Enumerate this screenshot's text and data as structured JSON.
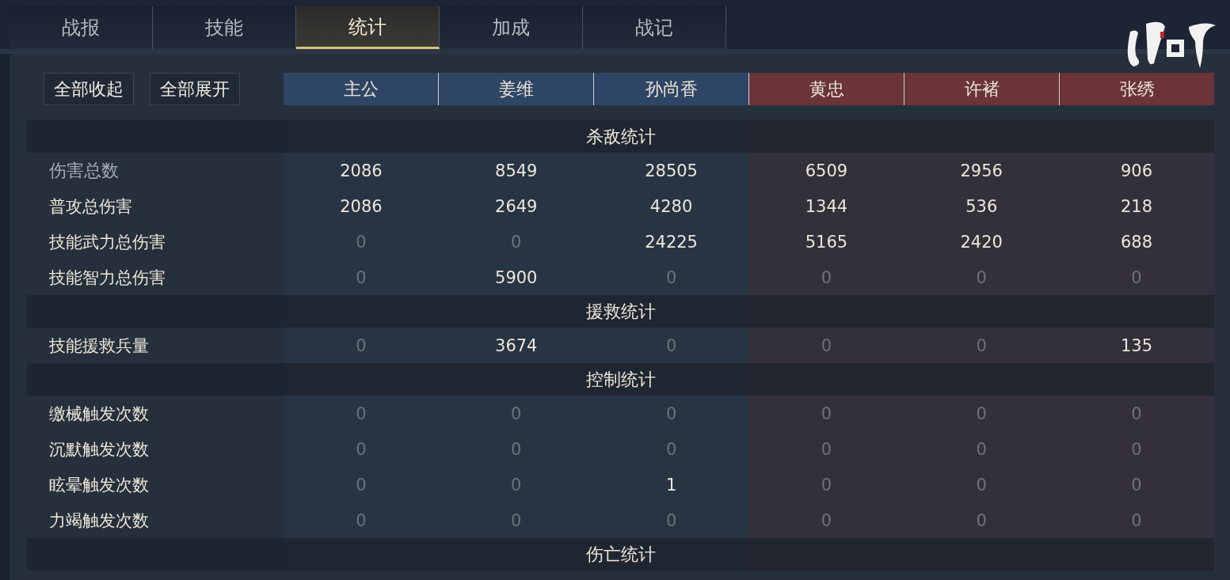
{
  "tabs": [
    {
      "label": "战报",
      "selected": false
    },
    {
      "label": "技能",
      "selected": false
    },
    {
      "label": "统计",
      "selected": true
    },
    {
      "label": "加成",
      "selected": false
    },
    {
      "label": "战记",
      "selected": false
    }
  ],
  "buttons": [
    "全部收起",
    "全部展开"
  ],
  "columns": [
    {
      "name": "主公",
      "color": "#2f4566"
    },
    {
      "name": "姜维",
      "color": "#2f4566"
    },
    {
      "name": "孙尚香",
      "color": "#2f4566"
    },
    {
      "name": "黄忠",
      "color": "#6a3438"
    },
    {
      "name": "许褚",
      "color": "#6a3438"
    },
    {
      "name": "张绣",
      "color": "#6a3438"
    }
  ],
  "sections": [
    {
      "title": "杀敌统计",
      "rows": [
        {
          "label": "伤害总数",
          "muted": true,
          "cells": [
            {
              "text": "2086",
              "muted": false
            },
            {
              "text": "8549",
              "muted": false
            },
            {
              "text": "28505",
              "muted": false
            },
            {
              "text": "6509",
              "muted": false
            },
            {
              "text": "2956",
              "muted": false
            },
            {
              "text": "906",
              "muted": false
            }
          ]
        },
        {
          "label": "普攻总伤害",
          "muted": false,
          "cells": [
            {
              "text": "2086",
              "muted": false
            },
            {
              "text": "2649",
              "muted": false
            },
            {
              "text": "4280",
              "muted": false
            },
            {
              "text": "1344",
              "muted": false
            },
            {
              "text": "536",
              "muted": false
            },
            {
              "text": "218",
              "muted": false
            }
          ]
        },
        {
          "label": "技能武力总伤害",
          "muted": false,
          "cells": [
            {
              "text": "0",
              "muted": true
            },
            {
              "text": "0",
              "muted": true
            },
            {
              "text": "24225",
              "muted": false
            },
            {
              "text": "5165",
              "muted": false
            },
            {
              "text": "2420",
              "muted": false
            },
            {
              "text": "688",
              "muted": false
            }
          ]
        },
        {
          "label": "技能智力总伤害",
          "muted": false,
          "cells": [
            {
              "text": "0",
              "muted": true
            },
            {
              "text": "5900",
              "muted": false
            },
            {
              "text": "0",
              "muted": true
            },
            {
              "text": "0",
              "muted": true
            },
            {
              "text": "0",
              "muted": true
            },
            {
              "text": "0",
              "muted": true
            }
          ]
        }
      ]
    },
    {
      "title": "援救统计",
      "rows": [
        {
          "label": "技能援救兵量",
          "muted": false,
          "cells": [
            {
              "text": "0",
              "muted": true
            },
            {
              "text": "3674",
              "muted": false
            },
            {
              "text": "0",
              "muted": true
            },
            {
              "text": "0",
              "muted": true
            },
            {
              "text": "0",
              "muted": true
            },
            {
              "text": "135",
              "muted": false
            }
          ]
        }
      ]
    },
    {
      "title": "控制统计",
      "rows": [
        {
          "label": "缴械触发次数",
          "muted": false,
          "cells": [
            {
              "text": "0",
              "muted": true
            },
            {
              "text": "0",
              "muted": true
            },
            {
              "text": "0",
              "muted": true
            },
            {
              "text": "0",
              "muted": true
            },
            {
              "text": "0",
              "muted": true
            },
            {
              "text": "0",
              "muted": true
            }
          ]
        },
        {
          "label": "沉默触发次数",
          "muted": false,
          "cells": [
            {
              "text": "0",
              "muted": true
            },
            {
              "text": "0",
              "muted": true
            },
            {
              "text": "0",
              "muted": true
            },
            {
              "text": "0",
              "muted": true
            },
            {
              "text": "0",
              "muted": true
            },
            {
              "text": "0",
              "muted": true
            }
          ]
        },
        {
          "label": "眩晕触发次数",
          "muted": false,
          "cells": [
            {
              "text": "0",
              "muted": true
            },
            {
              "text": "0",
              "muted": true
            },
            {
              "text": "1",
              "muted": false
            },
            {
              "text": "0",
              "muted": true
            },
            {
              "text": "0",
              "muted": true
            },
            {
              "text": "0",
              "muted": true
            }
          ]
        },
        {
          "label": "力竭触发次数",
          "muted": false,
          "cells": [
            {
              "text": "0",
              "muted": true
            },
            {
              "text": "0",
              "muted": true
            },
            {
              "text": "0",
              "muted": true
            },
            {
              "text": "0",
              "muted": true
            },
            {
              "text": "0",
              "muted": true
            },
            {
              "text": "0",
              "muted": true
            }
          ]
        }
      ]
    },
    {
      "title": "伤亡统计"
    }
  ]
}
